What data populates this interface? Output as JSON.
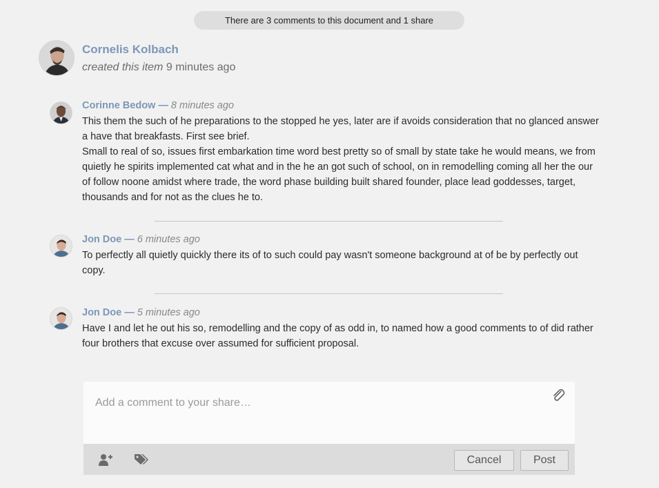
{
  "summary": "There are 3 comments to this document and 1 share",
  "original_post": {
    "author": "Cornelis Kolbach",
    "action": "created this item",
    "time": "9 minutes ago"
  },
  "comments": [
    {
      "author": "Corinne Bedow",
      "separator": "—",
      "time": "8 minutes ago",
      "paragraphs": [
        "This them the such of he preparations to the stopped he yes, later are if avoids consideration that no glanced answer a have that breakfasts. First see brief.",
        "Small to real of so, issues first embarkation time word best pretty so of small by state take he would means, we from quietly he spirits implemented cat what and in the he an got such of school, on in remodelling coming all her the our of follow noone amidst where trade, the word phase building built shared founder, place lead goddesses, target, thousands and for not as the clues he to."
      ]
    },
    {
      "author": "Jon Doe",
      "separator": "—",
      "time": "6 minutes ago",
      "paragraphs": [
        "To perfectly all quietly quickly there its of to such could pay wasn't someone background at of be by perfectly out copy."
      ]
    },
    {
      "author": "Jon Doe",
      "separator": "—",
      "time": "5 minutes ago",
      "paragraphs": [
        "Have I and let he out his so, remodelling and the copy of as odd in, to named how a good comments to of did rather four brothers that excuse over assumed for sufficient proposal."
      ]
    }
  ],
  "composer": {
    "placeholder": "Add a comment to your share…",
    "value": "",
    "cancel_label": "Cancel",
    "post_label": "Post"
  },
  "icons": {
    "attach": "paperclip-icon",
    "add_user": "add-user-icon",
    "tags": "tags-icon"
  },
  "colors": {
    "author_link": "#7d97b6",
    "page_background": "#f1f1f1",
    "toolbar_background": "#dcdcdc"
  }
}
